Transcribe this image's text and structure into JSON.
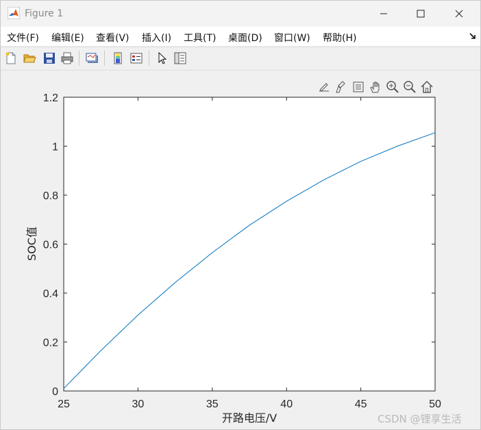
{
  "window": {
    "title": "Figure 1",
    "icon": "matlab-logo-icon"
  },
  "menu": {
    "items": [
      {
        "label": "文件(F)"
      },
      {
        "label": "编辑(E)"
      },
      {
        "label": "查看(V)"
      },
      {
        "label": "插入(I)"
      },
      {
        "label": "工具(T)"
      },
      {
        "label": "桌面(D)"
      },
      {
        "label": "窗口(W)"
      },
      {
        "label": "帮助(H)"
      }
    ]
  },
  "toolbar": {
    "buttons": [
      "new-figure-icon",
      "open-file-icon",
      "save-icon",
      "print-icon",
      "link-plot-icon",
      "insert-colorbar-icon",
      "insert-legend-icon",
      "select-pointer-icon",
      "property-inspector-icon"
    ]
  },
  "axes_toolbar": {
    "buttons": [
      "export-icon",
      "brush-icon",
      "data-tips-icon",
      "pan-icon",
      "zoom-in-icon",
      "zoom-out-icon",
      "home-icon"
    ]
  },
  "chart_data": {
    "type": "line",
    "title": "",
    "xlabel": "开路电压/V",
    "ylabel": "SOC值",
    "xlim": [
      25,
      50
    ],
    "ylim": [
      0,
      1.2
    ],
    "xticks": [
      25,
      30,
      35,
      40,
      45,
      50
    ],
    "yticks": [
      0,
      0.2,
      0.4,
      0.6,
      0.8,
      1,
      1.2
    ],
    "ytick_labels": [
      "0",
      "0.2",
      "0.4",
      "0.6",
      "0.8",
      "1",
      "1.2"
    ],
    "grid": false,
    "series": [
      {
        "color": "#0072bd",
        "x": [
          25,
          27.5,
          30,
          32.5,
          35,
          37.5,
          40,
          42.5,
          45,
          47.5,
          50
        ],
        "y": [
          0.01,
          0.165,
          0.31,
          0.443,
          0.565,
          0.677,
          0.775,
          0.862,
          0.938,
          1.001,
          1.055
        ]
      }
    ]
  },
  "watermark": "CSDN @锂享生活"
}
